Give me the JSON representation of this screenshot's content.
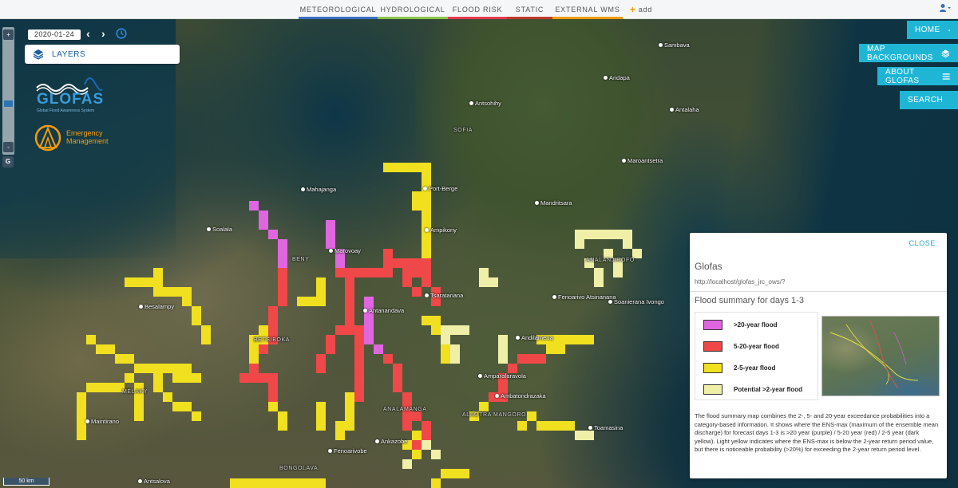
{
  "tabs": [
    {
      "label": "METEOROLOGICAL",
      "color": "#3a6fc4"
    },
    {
      "label": "HYDROLOGICAL",
      "color": "#8bc34a"
    },
    {
      "label": "FLOOD RISK",
      "color": "#e53950"
    },
    {
      "label": "STATIC",
      "color": "#c0392b"
    },
    {
      "label": "EXTERNAL WMS",
      "color": "#f39c12"
    },
    {
      "label": "add",
      "color": "#f5f6f7"
    }
  ],
  "user_menu_icon": "user-icon",
  "zoom": {
    "in_label": "+",
    "out_label": "-",
    "globe_label": "G"
  },
  "date": {
    "value": "2020-01-24"
  },
  "layers_button": {
    "label": "LAYERS"
  },
  "logos": {
    "glofas": {
      "name": "GLOFAS",
      "subtitle": "Global Flood Awareness System"
    },
    "emergency": {
      "line1": "Emergency",
      "line2": "Management"
    }
  },
  "nav": {
    "home": "HOME",
    "backgrounds": "MAP BACKGROUNDS",
    "about": "ABOUT GLOFAS",
    "search": "SEARCH"
  },
  "places": [
    {
      "name": "Sambava",
      "kind": "city"
    },
    {
      "name": "Andapa",
      "kind": "city"
    },
    {
      "name": "Antsohihy",
      "kind": "city"
    },
    {
      "name": "Antalaha",
      "kind": "city"
    },
    {
      "name": "SOFIA",
      "kind": "region"
    },
    {
      "name": "Maroantsetra",
      "kind": "city"
    },
    {
      "name": "Port-Berge",
      "kind": "city"
    },
    {
      "name": "Mahajanga",
      "kind": "city"
    },
    {
      "name": "Mandritsara",
      "kind": "city"
    },
    {
      "name": "Soalala",
      "kind": "city"
    },
    {
      "name": "Marovoay",
      "kind": "city"
    },
    {
      "name": "Ampikony",
      "kind": "city"
    },
    {
      "name": "BENY",
      "kind": "region"
    },
    {
      "name": "Tsaratanana",
      "kind": "city"
    },
    {
      "name": "Fenoarivo Atsinanana",
      "kind": "city"
    },
    {
      "name": "Soanierana Ivongo",
      "kind": "city"
    },
    {
      "name": "ANALANJIROFO",
      "kind": "region"
    },
    {
      "name": "Besalampy",
      "kind": "city"
    },
    {
      "name": "Andilamena",
      "kind": "city"
    },
    {
      "name": "Antanandava",
      "kind": "city"
    },
    {
      "name": "BETSIBOKA",
      "kind": "region"
    },
    {
      "name": "Amparafaravola",
      "kind": "city"
    },
    {
      "name": "Ambatondrazaka",
      "kind": "city"
    },
    {
      "name": "MELAKY",
      "kind": "region"
    },
    {
      "name": "Maintirano",
      "kind": "city"
    },
    {
      "name": "ALAOTRA MANGORO",
      "kind": "region"
    },
    {
      "name": "Toamasina",
      "kind": "city"
    },
    {
      "name": "Ankazobe",
      "kind": "city"
    },
    {
      "name": "ANALAMANGA",
      "kind": "region"
    },
    {
      "name": "Fenoarivobe",
      "kind": "city"
    },
    {
      "name": "BONGOLAVA",
      "kind": "region"
    },
    {
      "name": "Antsalova",
      "kind": "city"
    }
  ],
  "scale": {
    "label": "50 km"
  },
  "flood_colors": {
    "over20": "#e066e0",
    "five20": "#f04848",
    "two5": "#f0e020",
    "potential": "#f0efa8"
  },
  "panel": {
    "close": "CLOSE",
    "title": "Glofas",
    "url": "http://localhost/glofas_jrc_ows/?",
    "subtitle": "Flood summary for days 1-3",
    "legend": [
      {
        "label": ">20-year flood",
        "color": "#e066e0"
      },
      {
        "label": "5-20-year flood",
        "color": "#f04848"
      },
      {
        "label": "2-5-year flood",
        "color": "#f0e020"
      },
      {
        "label": "Potential >2-year flood",
        "color": "#f0efa8"
      }
    ],
    "description": "The flood summary map combines the 2-, 5- and 20-year exceedance probabilities into a category-based information. It shows where the ENS-max (maximum of the ensemble mean discharge) for forecast days 1-3 is >20 year (purple) / 5-20 year (red) / 2-5 year (dark yellow). Light yellow indicates where the ENS-max is below the 2-year return period value, but there is noticeable probability (>20%) for exceeding the 2-year return period level."
  }
}
